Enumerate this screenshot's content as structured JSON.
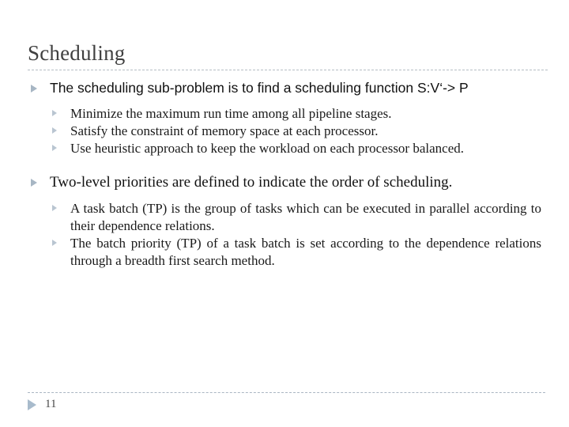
{
  "slide": {
    "title": "Scheduling",
    "page_number": "11",
    "accent_color": "#a7b6c4",
    "rule_color": "#b6bdc4",
    "title_color": "#404040",
    "text_color": "#111111",
    "background": "#ffffff"
  },
  "content": {
    "bullets": [
      {
        "text": "The scheduling sub-problem is to find a scheduling function S:V‘-> P",
        "sub": [
          "Minimize the maximum run time among all pipeline stages.",
          "Satisfy the constraint of memory space at each processor.",
          "Use heuristic approach to keep the workload on each processor balanced."
        ]
      },
      {
        "text": "Two-level priorities are defined to indicate the order of scheduling.",
        "sub": [
          "A task batch (TP) is the group of tasks which can be executed in parallel according to their dependence relations.",
          "The batch priority (TP) of a task batch is set according to the dependence relations through a breadth first search method."
        ]
      }
    ]
  }
}
